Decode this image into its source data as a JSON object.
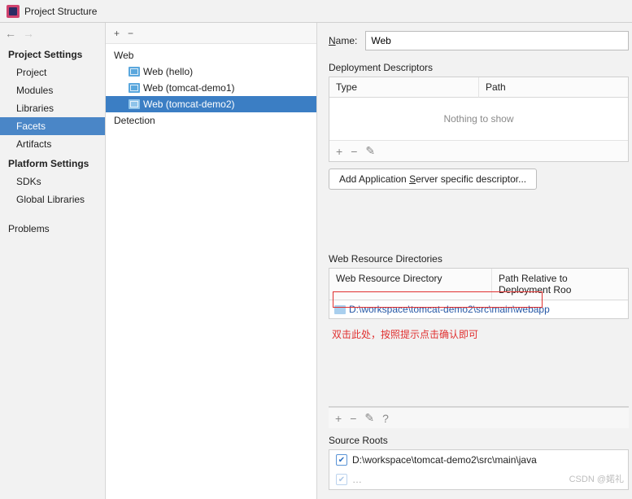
{
  "window": {
    "title": "Project Structure"
  },
  "nav": {
    "settings_title": "Project Settings",
    "items": [
      "Project",
      "Modules",
      "Libraries",
      "Facets",
      "Artifacts"
    ],
    "platform_title": "Platform Settings",
    "platform_items": [
      "SDKs",
      "Global Libraries"
    ],
    "problems": "Problems"
  },
  "tree": {
    "root": "Web",
    "children": [
      "Web (hello)",
      "Web (tomcat-demo1)",
      "Web (tomcat-demo2)"
    ],
    "detection": "Detection"
  },
  "main": {
    "name_label": "Name:",
    "name_value": "Web",
    "dd_title": "Deployment Descriptors",
    "dd_cols": {
      "type": "Type",
      "path": "Path"
    },
    "dd_empty": "Nothing to show",
    "add_server_btn": "Add Application Server specific descriptor...",
    "wr_title": "Web Resource Directories",
    "wr_cols": {
      "dir": "Web Resource Directory",
      "rel": "Path Relative to Deployment Roo"
    },
    "wr_path": "D:\\workspace\\tomcat-demo2\\src\\main\\webapp",
    "annotation": "双击此处，按照提示点击确认即可",
    "sr_title": "Source Roots",
    "sr_item": "D:\\workspace\\tomcat-demo2\\src\\main\\java"
  },
  "watermark": "CSDN @婼礼"
}
